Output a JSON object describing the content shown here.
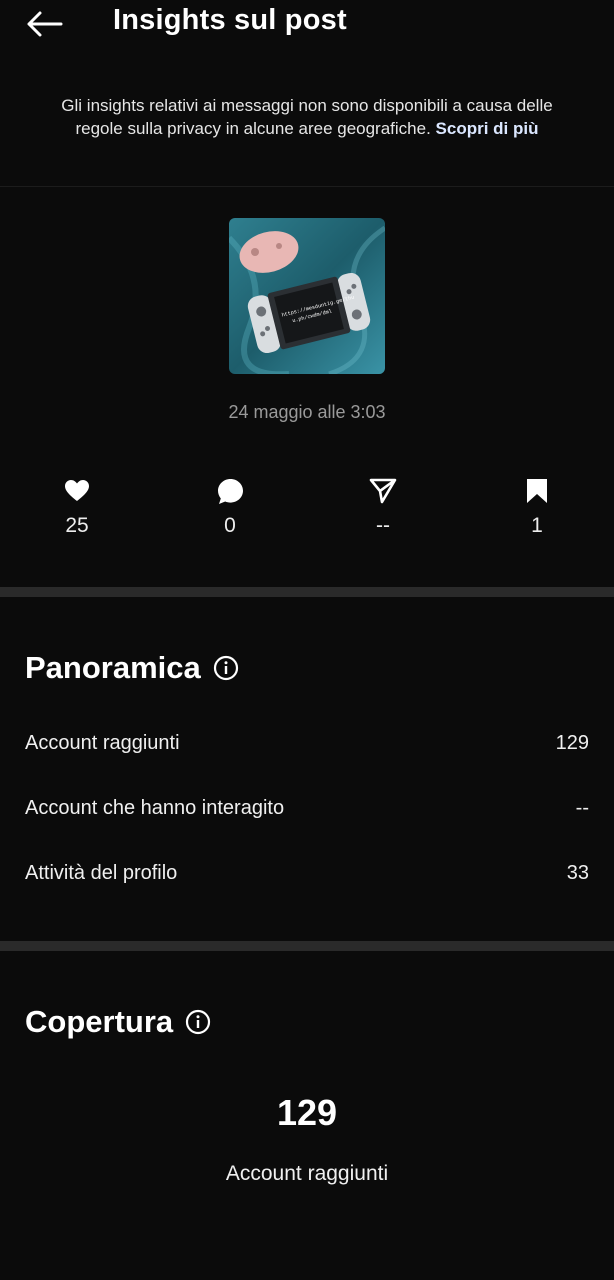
{
  "header": {
    "title": "Insights sul post",
    "back_icon": "arrow-left-icon"
  },
  "notice": {
    "text": "Gli insights relativi ai messaggi non sono disponibili a causa delle regole sulla privacy in alcune aree geografiche.",
    "link": "Scopri di più"
  },
  "post": {
    "thumbnail_overlay_line1": "https://mesduntig.ge/thu",
    "thumbnail_overlay_line2": "u.ph/cwdm/dml",
    "date": "24 maggio alle 3:03"
  },
  "stats": [
    {
      "icon": "heart-icon",
      "value": "25"
    },
    {
      "icon": "comment-icon",
      "value": "0"
    },
    {
      "icon": "send-icon",
      "value": "--"
    },
    {
      "icon": "bookmark-icon",
      "value": "1"
    }
  ],
  "overview": {
    "title": "Panoramica",
    "rows": [
      {
        "label": "Account raggiunti",
        "value": "129"
      },
      {
        "label": "Account che hanno interagito",
        "value": "--"
      },
      {
        "label": "Attività del profilo",
        "value": "33"
      }
    ]
  },
  "coverage": {
    "title": "Copertura",
    "number": "129",
    "label": "Account raggiunti"
  },
  "colors": {
    "background": "#0b0b0b",
    "text": "#f2f2f2",
    "muted": "#9a9a9a",
    "link": "#dbe7ff",
    "separator": "#2a2a2a"
  }
}
